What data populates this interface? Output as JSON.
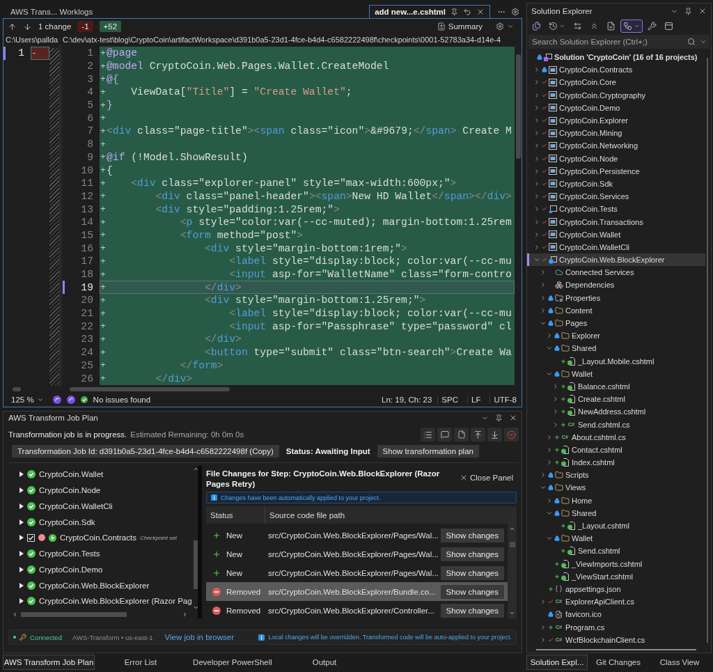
{
  "document_tabs": [
    {
      "label": "AWS Trans... Worklogs",
      "selected": false
    },
    {
      "label": "add new...e.cshtml",
      "selected": true
    }
  ],
  "diff_toolbar": {
    "change_count": "1 change",
    "removed": "-1",
    "added": "+52",
    "summary": "Summary"
  },
  "left_pane": {
    "kind": "removed",
    "path": "C:\\Users\\pallda",
    "lines": [
      {
        "number": "1",
        "marker": "-",
        "current": true
      }
    ]
  },
  "right_pane": {
    "kind": "added",
    "path": "C:\\dev\\atx-test\\blog\\CryptoCoin\\artifactWorkspace\\d391b0a5-23d1-4fce-b4d4-c6582222498f\\checkpoints\\0001-52783a34-d14e-4",
    "lines": [
      {
        "number": "1",
        "marker": "+",
        "current": false,
        "tokens": [
          {
            "kind": "razor",
            "text": "@page"
          }
        ]
      },
      {
        "number": "2",
        "marker": "+",
        "current": false,
        "tokens": [
          {
            "kind": "razor",
            "text": "@model"
          },
          {
            "kind": "text",
            "text": " CryptoCoin.Web.Pages.Wallet.CreateModel"
          }
        ]
      },
      {
        "number": "3",
        "marker": "+",
        "current": false,
        "tokens": [
          {
            "kind": "razor",
            "text": "@{"
          }
        ]
      },
      {
        "number": "4",
        "marker": "+",
        "current": false,
        "tokens": [
          {
            "kind": "text",
            "text": "    ViewData["
          },
          {
            "kind": "string",
            "text": "\"Title\""
          },
          {
            "kind": "text",
            "text": "] = "
          },
          {
            "kind": "string",
            "text": "\"Create Wallet\""
          },
          {
            "kind": "text",
            "text": ";"
          }
        ]
      },
      {
        "number": "5",
        "marker": "+",
        "current": false,
        "tokens": [
          {
            "kind": "razor",
            "text": "}"
          }
        ]
      },
      {
        "number": "6",
        "marker": "+",
        "current": false
      },
      {
        "number": "7",
        "marker": "+",
        "current": false,
        "tokens": [
          {
            "kind": "punct",
            "text": "<"
          },
          {
            "kind": "tag",
            "text": "div"
          },
          {
            "kind": "text",
            "text": " class=\"page-title\""
          },
          {
            "kind": "punct",
            "text": "><"
          },
          {
            "kind": "tag",
            "text": "span"
          },
          {
            "kind": "text",
            "text": " class=\"icon\""
          },
          {
            "kind": "punct",
            "text": ">"
          },
          {
            "kind": "text",
            "text": "&#9679;"
          },
          {
            "kind": "punct",
            "text": "</"
          },
          {
            "kind": "tag",
            "text": "span"
          },
          {
            "kind": "punct",
            "text": ">"
          },
          {
            "kind": "text",
            "text": " Create M"
          }
        ]
      },
      {
        "number": "8",
        "marker": "+",
        "current": false
      },
      {
        "number": "9",
        "marker": "+",
        "current": false,
        "tokens": [
          {
            "kind": "razor",
            "text": "@if"
          },
          {
            "kind": "text",
            "text": " (!Model.ShowResult)"
          }
        ]
      },
      {
        "number": "10",
        "marker": "+",
        "current": false,
        "tokens": [
          {
            "kind": "text",
            "text": "{"
          }
        ]
      },
      {
        "number": "11",
        "marker": "+",
        "current": false,
        "tokens": [
          {
            "kind": "punct",
            "text": "    <"
          },
          {
            "kind": "tag",
            "text": "div"
          },
          {
            "kind": "text",
            "text": " class=\"explorer-panel\" style=\"max-width:600px;\""
          },
          {
            "kind": "punct",
            "text": ">"
          }
        ]
      },
      {
        "number": "12",
        "marker": "+",
        "current": false,
        "tokens": [
          {
            "kind": "punct",
            "text": "        <"
          },
          {
            "kind": "tag",
            "text": "div"
          },
          {
            "kind": "text",
            "text": " class=\"panel-header\""
          },
          {
            "kind": "punct",
            "text": "><"
          },
          {
            "kind": "tag",
            "text": "span"
          },
          {
            "kind": "punct",
            "text": ">"
          },
          {
            "kind": "text",
            "text": "New HD Wallet"
          },
          {
            "kind": "punct",
            "text": "</"
          },
          {
            "kind": "tag",
            "text": "span"
          },
          {
            "kind": "punct",
            "text": "></"
          },
          {
            "kind": "tag",
            "text": "div"
          },
          {
            "kind": "punct",
            "text": ">"
          }
        ]
      },
      {
        "number": "13",
        "marker": "+",
        "current": false,
        "tokens": [
          {
            "kind": "punct",
            "text": "        <"
          },
          {
            "kind": "tag",
            "text": "div"
          },
          {
            "kind": "text",
            "text": " style=\"padding:1.25rem;\""
          },
          {
            "kind": "punct",
            "text": ">"
          }
        ]
      },
      {
        "number": "14",
        "marker": "+",
        "current": false,
        "tokens": [
          {
            "kind": "punct",
            "text": "            <"
          },
          {
            "kind": "tag",
            "text": "p"
          },
          {
            "kind": "text",
            "text": " style=\"color:var(--cc-muted); margin-bottom:1.25rem"
          }
        ]
      },
      {
        "number": "15",
        "marker": "+",
        "current": false,
        "tokens": [
          {
            "kind": "punct",
            "text": "            <"
          },
          {
            "kind": "tag",
            "text": "form"
          },
          {
            "kind": "text",
            "text": " method=\"post\""
          },
          {
            "kind": "punct",
            "text": ">"
          }
        ]
      },
      {
        "number": "16",
        "marker": "+",
        "current": false,
        "tokens": [
          {
            "kind": "punct",
            "text": "                <"
          },
          {
            "kind": "tag",
            "text": "div"
          },
          {
            "kind": "text",
            "text": " style=\"margin-bottom:1rem;\""
          },
          {
            "kind": "punct",
            "text": ">"
          }
        ]
      },
      {
        "number": "17",
        "marker": "+",
        "current": false,
        "tokens": [
          {
            "kind": "punct",
            "text": "                    <"
          },
          {
            "kind": "tag",
            "text": "label"
          },
          {
            "kind": "text",
            "text": " style=\"display:block; color:var(--cc-mu"
          }
        ]
      },
      {
        "number": "18",
        "marker": "+",
        "current": false,
        "tokens": [
          {
            "kind": "punct",
            "text": "                    <"
          },
          {
            "kind": "tag",
            "text": "input"
          },
          {
            "kind": "text",
            "text": " asp-for=\"WalletName\" class=\"form-contro"
          }
        ]
      },
      {
        "number": "19",
        "marker": "+",
        "current": true,
        "tokens": [
          {
            "kind": "punct",
            "text": "                </"
          },
          {
            "kind": "tag",
            "text": "div"
          },
          {
            "kind": "punct",
            "text": ">"
          }
        ]
      },
      {
        "number": "20",
        "marker": "+",
        "current": false,
        "tokens": [
          {
            "kind": "punct",
            "text": "                <"
          },
          {
            "kind": "tag",
            "text": "div"
          },
          {
            "kind": "text",
            "text": " style=\"margin-bottom:1.25rem;\""
          },
          {
            "kind": "punct",
            "text": ">"
          }
        ]
      },
      {
        "number": "21",
        "marker": "+",
        "current": false,
        "tokens": [
          {
            "kind": "punct",
            "text": "                    <"
          },
          {
            "kind": "tag",
            "text": "label"
          },
          {
            "kind": "text",
            "text": " style=\"display:block; color:var(--cc-mu"
          }
        ]
      },
      {
        "number": "22",
        "marker": "+",
        "current": false,
        "tokens": [
          {
            "kind": "punct",
            "text": "                    <"
          },
          {
            "kind": "tag",
            "text": "input"
          },
          {
            "kind": "text",
            "text": " asp-for=\"Passphrase\" type=\"password\" cl"
          }
        ]
      },
      {
        "number": "23",
        "marker": "+",
        "current": false,
        "tokens": [
          {
            "kind": "punct",
            "text": "                </"
          },
          {
            "kind": "tag",
            "text": "div"
          },
          {
            "kind": "punct",
            "text": ">"
          }
        ]
      },
      {
        "number": "24",
        "marker": "+",
        "current": false,
        "tokens": [
          {
            "kind": "punct",
            "text": "                <"
          },
          {
            "kind": "tag",
            "text": "button"
          },
          {
            "kind": "text",
            "text": " type=\"submit\" class=\"btn-search\""
          },
          {
            "kind": "punct",
            "text": ">"
          },
          {
            "kind": "text",
            "text": "Create Wa"
          }
        ]
      },
      {
        "number": "25",
        "marker": "+",
        "current": false,
        "tokens": [
          {
            "kind": "punct",
            "text": "            </"
          },
          {
            "kind": "tag",
            "text": "form"
          },
          {
            "kind": "punct",
            "text": ">"
          }
        ]
      },
      {
        "number": "26",
        "marker": "+",
        "current": false,
        "tokens": [
          {
            "kind": "punct",
            "text": "        </"
          },
          {
            "kind": "tag",
            "text": "div"
          },
          {
            "kind": "punct",
            "text": ">"
          }
        ]
      }
    ]
  },
  "editor_status": {
    "zoom": "125 %",
    "issues": "No issues found",
    "position": "Ln: 19, Ch: 23",
    "indent": "SPC",
    "line_ending": "LF",
    "encoding": "UTF-8"
  },
  "job_plan": {
    "title": "AWS Transform Job Plan",
    "progress": "Transformation job is in progress.",
    "remaining": "Estimated Remaining:  0h 0m 0s",
    "job_id_button": "Transformation Job Id: d391b0a5-23d1-4fce-b4d4-c6582222498f (Copy)",
    "status": "Status: Awaiting Input",
    "plan_button": "Show transformation plan",
    "steps": [
      {
        "kind": "done",
        "label": "CryptoCoin.Wallet"
      },
      {
        "kind": "done",
        "label": "CryptoCoin.Node"
      },
      {
        "kind": "done",
        "label": "CryptoCoin.WalletCli"
      },
      {
        "kind": "done",
        "label": "CryptoCoin.Sdk"
      },
      {
        "kind": "checkpoint",
        "label": "CryptoCoin.Contracts",
        "checked": true,
        "note": "Checkpoint set"
      },
      {
        "kind": "done",
        "label": "CryptoCoin.Tests"
      },
      {
        "kind": "done",
        "label": "CryptoCoin.Demo"
      },
      {
        "kind": "done",
        "label": "CryptoCoin.Web.BlockExplorer"
      },
      {
        "kind": "done",
        "label": "CryptoCoin.Web.BlockExplorer (Razor Pag"
      }
    ],
    "file_changes": {
      "title": "File Changes for Step:  CryptoCoin.Web.BlockExplorer (Razor Pages Retry)",
      "close": "Close Panel",
      "notice": "Changes have been automatically applied to your project.",
      "columns": [
        "Status",
        "Source code file path"
      ],
      "rows": [
        {
          "kind": "new",
          "status": "New",
          "path": "src/CryptoCoin.Web.BlockExplorer/Pages/Wal...",
          "action": "Show changes",
          "selected": false
        },
        {
          "kind": "new",
          "status": "New",
          "path": "src/CryptoCoin.Web.BlockExplorer/Pages/Wal...",
          "action": "Show changes",
          "selected": false
        },
        {
          "kind": "new",
          "status": "New",
          "path": "src/CryptoCoin.Web.BlockExplorer/Pages/Wal...",
          "action": "Show changes",
          "selected": false
        },
        {
          "kind": "removed",
          "status": "Removed",
          "path": "src/CryptoCoin.Web.BlockExplorer/Bundle.co...",
          "action": "Show changes",
          "selected": true
        },
        {
          "kind": "removed",
          "status": "Removed",
          "path": "src/CryptoCoin.Web.BlockExplorer/Controller...",
          "action": "Show changes",
          "selected": false
        }
      ]
    },
    "footer": {
      "connection": "Connected",
      "service": "AWS-Transform • us-east-1",
      "link": "View job in browser",
      "notice": "Local changes will be overridden. Transformed code will be auto-applied to your project."
    }
  },
  "bottom_tabs": [
    {
      "label": "AWS Transform Job Plan",
      "selected": true
    },
    {
      "label": "Error List",
      "selected": false
    },
    {
      "label": "Developer PowerShell",
      "selected": false
    },
    {
      "label": "Output",
      "selected": false
    }
  ],
  "solution_explorer": {
    "title": "Solution Explorer",
    "toolbar": [
      {
        "kind": "solutions",
        "on": false
      },
      {
        "kind": "history",
        "on": false
      },
      {
        "kind": "sync",
        "on": false
      },
      {
        "kind": "collapse",
        "on": false
      },
      {
        "kind": "filter",
        "on": false
      },
      {
        "kind": "tree",
        "on": true
      },
      {
        "kind": "properties",
        "on": false
      },
      {
        "kind": "preview",
        "on": false
      }
    ],
    "search": {
      "placeholder": "Search Solution Explorer (Ctrl+;)"
    },
    "solution": {
      "label": "Solution 'CryptoCoin' (16 of 16 projects)",
      "locked": true,
      "modified": false,
      "added": false,
      "selected": false
    },
    "items": [
      {
        "label": "CryptoCoin.Contracts",
        "kind": "project",
        "locked": true,
        "modified": false,
        "added": false,
        "expanded": false,
        "selected": false
      },
      {
        "label": "CryptoCoin.Core",
        "kind": "project",
        "locked": false,
        "modified": true,
        "added": false,
        "expanded": false,
        "selected": false
      },
      {
        "label": "CryptoCoin.Cryptography",
        "kind": "project",
        "locked": false,
        "modified": true,
        "added": false,
        "expanded": false,
        "selected": false
      },
      {
        "label": "CryptoCoin.Demo",
        "kind": "project",
        "locked": false,
        "modified": true,
        "added": false,
        "expanded": false,
        "selected": false
      },
      {
        "label": "CryptoCoin.Explorer",
        "kind": "project",
        "locked": false,
        "modified": true,
        "added": false,
        "expanded": false,
        "selected": false
      },
      {
        "label": "CryptoCoin.Mining",
        "kind": "project",
        "locked": false,
        "modified": true,
        "added": false,
        "expanded": false,
        "selected": false
      },
      {
        "label": "CryptoCoin.Networking",
        "kind": "project",
        "locked": false,
        "modified": true,
        "added": false,
        "expanded": false,
        "selected": false
      },
      {
        "label": "CryptoCoin.Node",
        "kind": "project",
        "locked": false,
        "modified": true,
        "added": false,
        "expanded": false,
        "selected": false
      },
      {
        "label": "CryptoCoin.Persistence",
        "kind": "project",
        "locked": false,
        "modified": true,
        "added": false,
        "expanded": false,
        "selected": false
      },
      {
        "label": "CryptoCoin.Sdk",
        "kind": "project",
        "locked": false,
        "modified": true,
        "added": false,
        "expanded": false,
        "selected": false
      },
      {
        "label": "CryptoCoin.Services",
        "kind": "project",
        "locked": false,
        "modified": true,
        "added": false,
        "expanded": false,
        "selected": false
      },
      {
        "label": "CryptoCoin.Tests",
        "kind": "test-project",
        "locked": false,
        "modified": true,
        "added": false,
        "expanded": false,
        "selected": false
      },
      {
        "label": "CryptoCoin.Transactions",
        "kind": "project",
        "locked": false,
        "modified": true,
        "added": false,
        "expanded": false,
        "selected": false
      },
      {
        "label": "CryptoCoin.Wallet",
        "kind": "project",
        "locked": false,
        "modified": true,
        "added": false,
        "expanded": false,
        "selected": false
      },
      {
        "label": "CryptoCoin.WalletCli",
        "kind": "project",
        "locked": false,
        "modified": true,
        "added": false,
        "expanded": false,
        "selected": false
      },
      {
        "label": "CryptoCoin.Web.BlockExplorer",
        "kind": "web-project",
        "locked": false,
        "modified": true,
        "added": false,
        "expanded": true,
        "selected": true,
        "children": [
          {
            "label": "Connected Services",
            "kind": "connected-services",
            "locked": false,
            "modified": false,
            "added": false,
            "expanded": false,
            "selected": false
          },
          {
            "label": "Dependencies",
            "kind": "dependencies",
            "locked": false,
            "modified": false,
            "added": false,
            "expanded": false,
            "selected": false
          },
          {
            "label": "Properties",
            "kind": "properties",
            "locked": true,
            "modified": false,
            "added": false,
            "expanded": false,
            "selected": false
          },
          {
            "label": "Content",
            "kind": "folder",
            "locked": true,
            "modified": false,
            "added": false,
            "expanded": false,
            "selected": false
          },
          {
            "label": "Pages",
            "kind": "folder",
            "locked": true,
            "modified": false,
            "added": false,
            "expanded": true,
            "selected": false,
            "children": [
              {
                "label": "Explorer",
                "kind": "folder",
                "locked": true,
                "modified": false,
                "added": false,
                "expanded": false,
                "selected": false
              },
              {
                "label": "Shared",
                "kind": "folder",
                "locked": true,
                "modified": false,
                "added": false,
                "expanded": true,
                "selected": false,
                "children": [
                  {
                    "label": "_Layout.Mobile.cshtml",
                    "kind": "razor",
                    "locked": false,
                    "modified": false,
                    "added": true,
                    "selected": false
                  }
                ]
              },
              {
                "label": "Wallet",
                "kind": "folder",
                "locked": true,
                "modified": false,
                "added": false,
                "expanded": true,
                "selected": false,
                "children": [
                  {
                    "label": "Balance.cshtml",
                    "kind": "razor",
                    "locked": false,
                    "modified": false,
                    "added": true,
                    "expanded": false,
                    "selected": false
                  },
                  {
                    "label": "Create.cshtml",
                    "kind": "razor",
                    "locked": false,
                    "modified": false,
                    "added": true,
                    "expanded": false,
                    "selected": false
                  },
                  {
                    "label": "NewAddress.cshtml",
                    "kind": "razor",
                    "locked": false,
                    "modified": false,
                    "added": true,
                    "expanded": false,
                    "selected": false
                  },
                  {
                    "label": "Send.cshtml.cs",
                    "kind": "csharp",
                    "type_label": "C#",
                    "locked": false,
                    "modified": false,
                    "added": true,
                    "expanded": false,
                    "selected": false
                  }
                ]
              },
              {
                "label": "About.cshtml.cs",
                "kind": "csharp",
                "type_label": "C#",
                "locked": false,
                "modified": false,
                "added": true,
                "expanded": false,
                "selected": false
              },
              {
                "label": "Contact.cshtml",
                "kind": "razor",
                "locked": false,
                "modified": false,
                "added": true,
                "expanded": false,
                "selected": false
              },
              {
                "label": "Index.cshtml",
                "kind": "razor",
                "locked": false,
                "modified": false,
                "added": true,
                "expanded": false,
                "selected": false
              }
            ]
          },
          {
            "label": "Scripts",
            "kind": "folder",
            "locked": true,
            "modified": false,
            "added": false,
            "expanded": false,
            "selected": false
          },
          {
            "label": "Views",
            "kind": "folder",
            "locked": true,
            "modified": false,
            "added": false,
            "expanded": true,
            "selected": false,
            "children": [
              {
                "label": "Home",
                "kind": "folder",
                "locked": true,
                "modified": false,
                "added": false,
                "expanded": false,
                "selected": false
              },
              {
                "label": "Shared",
                "kind": "folder",
                "locked": true,
                "modified": false,
                "added": false,
                "expanded": true,
                "selected": false,
                "children": [
                  {
                    "label": "_Layout.cshtml",
                    "kind": "razor",
                    "locked": false,
                    "modified": false,
                    "added": true,
                    "selected": false
                  }
                ]
              },
              {
                "label": "Wallet",
                "kind": "folder",
                "locked": true,
                "modified": false,
                "added": false,
                "expanded": true,
                "selected": false,
                "children": [
                  {
                    "label": "Send.cshtml",
                    "kind": "razor",
                    "locked": false,
                    "modified": false,
                    "added": true,
                    "selected": false
                  }
                ]
              },
              {
                "label": "_ViewImports.cshtml",
                "kind": "razor",
                "locked": false,
                "modified": false,
                "added": true,
                "selected": false
              },
              {
                "label": "_ViewStart.cshtml",
                "kind": "razor",
                "locked": false,
                "modified": false,
                "added": true,
                "selected": false
              }
            ]
          },
          {
            "label": "appsettings.json",
            "kind": "json",
            "locked": false,
            "modified": false,
            "added": true,
            "selected": false
          },
          {
            "label": "ExplorerApiClient.cs",
            "kind": "csharp",
            "type_label": "C#",
            "locked": false,
            "modified": true,
            "added": false,
            "expanded": false,
            "selected": false
          },
          {
            "label": "favicon.ico",
            "kind": "icon-file",
            "locked": true,
            "modified": false,
            "added": false,
            "selected": false
          },
          {
            "label": "Program.cs",
            "kind": "csharp",
            "type_label": "C#",
            "locked": false,
            "modified": false,
            "added": true,
            "expanded": false,
            "selected": false
          },
          {
            "label": "WcfBlockchainClient.cs",
            "kind": "csharp",
            "type_label": "C#",
            "locked": false,
            "modified": true,
            "added": false,
            "expanded": false,
            "selected": false
          }
        ]
      }
    ]
  },
  "explorer_tabs": [
    {
      "label": "Solution Expl...",
      "selected": true
    },
    {
      "label": "Git Changes",
      "selected": false
    },
    {
      "label": "Class View",
      "selected": false
    }
  ]
}
